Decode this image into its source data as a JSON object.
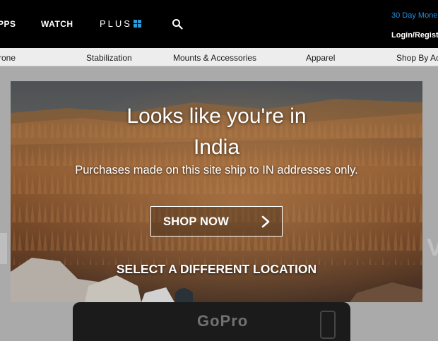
{
  "header": {
    "nav": [
      "PPS",
      "WATCH"
    ],
    "plus_label": "PLUS",
    "promo_text": "30 Day Mone",
    "login_text": "Login/Regist"
  },
  "category_nav": [
    "rone",
    "Stabilization",
    "Mounts & Accessories",
    "Apparel",
    "Shop By Ac"
  ],
  "background": {
    "hero_right_glyph": "V",
    "camera_brand": "GoPro"
  },
  "modal": {
    "title_line1": "Looks like you're in",
    "title_line2": "India",
    "subtitle": "Purchases made on this site ship to IN addresses only.",
    "shop_button": "SHOP NOW",
    "select_location": "SELECT A DIFFERENT LOCATION"
  },
  "icons": {
    "search": "search-icon",
    "chevron": "chevron-right-icon",
    "plus_grid": "plus-grid-icon"
  },
  "colors": {
    "header_bg": "#000000",
    "promo_link": "#1f8fe0",
    "plus_accent": "#2f9bd6",
    "modal_text": "#ffffff"
  }
}
